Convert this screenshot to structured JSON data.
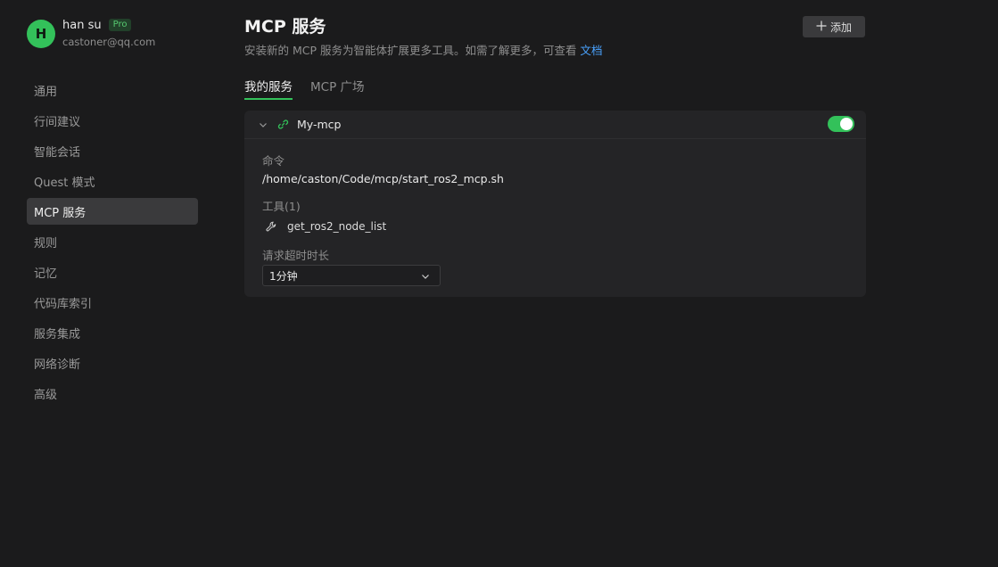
{
  "user": {
    "avatar_letter": "H",
    "name": "han su",
    "badge": "Pro",
    "email": "castoner@qq.com"
  },
  "sidebar": {
    "items": [
      {
        "label": "通用"
      },
      {
        "label": "行间建议"
      },
      {
        "label": "智能会话"
      },
      {
        "label": "Quest 模式"
      },
      {
        "label": "MCP 服务",
        "active": true
      },
      {
        "label": "规则"
      },
      {
        "label": "记忆"
      },
      {
        "label": "代码库索引"
      },
      {
        "label": "服务集成"
      },
      {
        "label": "网络诊断"
      },
      {
        "label": "高级"
      }
    ]
  },
  "header": {
    "title": "MCP 服务",
    "description": "安装新的 MCP 服务为智能体扩展更多工具。如需了解更多，可查看",
    "doc_link": "文档",
    "add_button": "添加"
  },
  "tabs": [
    {
      "label": "我的服务",
      "active": true
    },
    {
      "label": "MCP 广场",
      "active": false
    }
  ],
  "server": {
    "name": "My-mcp",
    "enabled": true,
    "command_label": "命令",
    "command": "/home/caston/Code/mcp/start_ros2_mcp.sh",
    "tools_label": "工具(1)",
    "tools": [
      "get_ros2_node_list"
    ],
    "timeout_label": "请求超时时长",
    "timeout_value": "1分钟"
  },
  "colors": {
    "accent": "#33c15a",
    "link": "#4aa3ff",
    "background": "#1b1b1c",
    "card": "#242426"
  },
  "icons": {
    "add": "plus-icon",
    "expand": "chevron-down-icon",
    "server_type": "link-icon",
    "tool": "wrench-icon"
  }
}
